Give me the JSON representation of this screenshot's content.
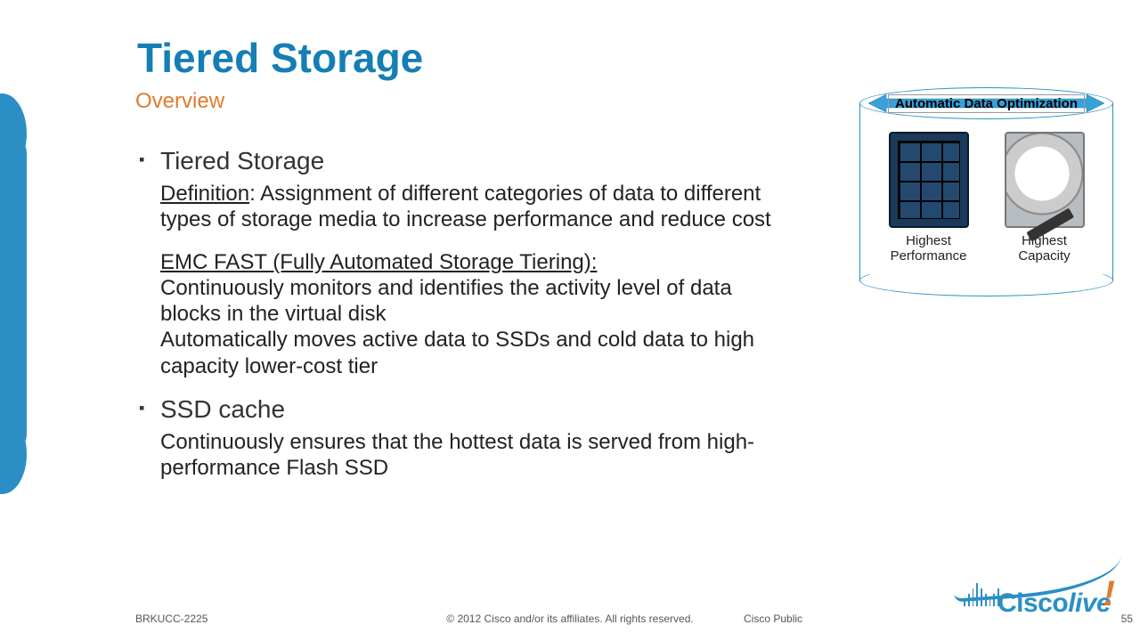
{
  "title": "Tiered Storage",
  "subtitle": "Overview",
  "bullets": [
    {
      "heading": "Tiered Storage"
    },
    {
      "heading": "SSD cache"
    }
  ],
  "paragraphs": {
    "definition_label": "Definition",
    "definition_text": ": Assignment of different categories of data to different types of storage media to increase performance and reduce cost",
    "fast_label": "EMC FAST (Fully Automated Storage Tiering):",
    "fast_line1": "Continuously monitors and identifies the activity level of data blocks in the virtual disk",
    "fast_line2": "Automatically moves active data to SSDs and cold data to high capacity lower-cost tier",
    "ssd_cache_text": "Continuously ensures that the hottest data is served from high-performance Flash SSD"
  },
  "diagram": {
    "banner": "Automatic Data Optimization",
    "left_label": "Highest Performance",
    "right_label": "Highest Capacity"
  },
  "footer": {
    "code": "BRKUCC-2225",
    "copyright": "© 2012 Cisco and/or its affiliates. All rights reserved.",
    "classification": "Cisco Public",
    "page": "55"
  },
  "logo": {
    "brand": "Cisco",
    "suffix": "live",
    "bars": [
      8,
      14,
      20,
      26,
      20,
      14,
      8,
      14,
      20
    ]
  }
}
